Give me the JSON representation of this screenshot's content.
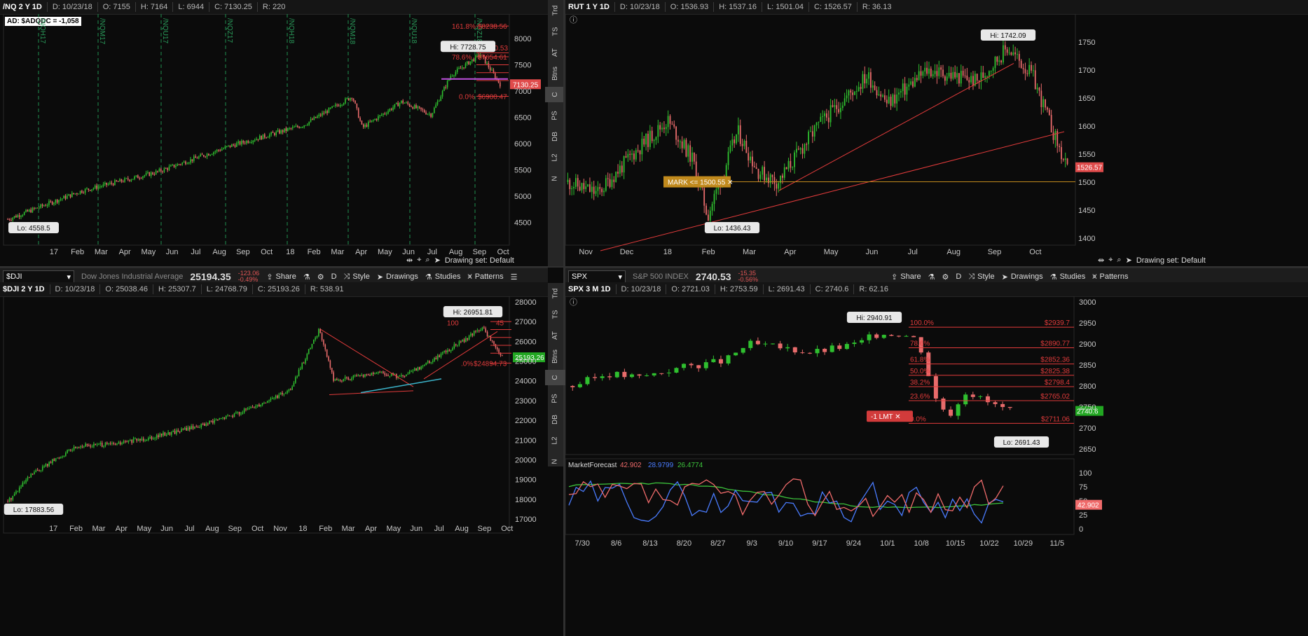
{
  "panels": {
    "nq": {
      "header": {
        "symbol": "/NQ 2 Y 1D",
        "date": "D: 10/23/18",
        "open": "O: 7155",
        "high": "H: 7164",
        "low": "L: 6944",
        "close": "C: 7130.25",
        "range": "R: 220"
      },
      "ad_label": "AD: $ADQDC = -1,058",
      "hi_label": "Hi: 7728.75",
      "lo_label": "Lo: 4558.5",
      "price_badge": "7130.25",
      "fib_labels": [
        "161.8%",
        "$8238.56",
        "78.6%",
        "$7654.61",
        "0.0%",
        "$6900.47",
        "30.53"
      ],
      "y_ticks": [
        "8000",
        "7500",
        "7000",
        "6500",
        "6000",
        "5500",
        "5000",
        "4500"
      ],
      "x_ticks": [
        "17",
        "Feb",
        "Mar",
        "Apr",
        "May",
        "Jun",
        "Jul",
        "Aug",
        "Sep",
        "Oct",
        "18",
        "Feb",
        "Mar",
        "Apr",
        "May",
        "Jun",
        "Jul",
        "Aug",
        "Sep",
        "Oct"
      ],
      "contract_marks": [
        "/NQH17",
        "/NQM17",
        "/NQU17",
        "/NQZ17",
        "/NQH18",
        "/NQM18",
        "/NQU18",
        "/NQZ18"
      ]
    },
    "rut": {
      "header": {
        "symbol": "RUT 1 Y 1D",
        "date": "D: 10/23/18",
        "open": "O: 1536.93",
        "high": "H: 1537.16",
        "low": "L: 1501.04",
        "close": "C: 1526.57",
        "range": "R: 36.13"
      },
      "hi_label": "Hi: 1742.09",
      "lo_label": "Lo: 1436.43",
      "mark_label": "MARK <= 1500.55",
      "price_badge": "1526.57",
      "y_ticks": [
        "1750",
        "1700",
        "1650",
        "1600",
        "1550",
        "1500",
        "1450",
        "1400"
      ],
      "x_ticks": [
        "Nov",
        "Dec",
        "18",
        "Feb",
        "Mar",
        "Apr",
        "May",
        "Jun",
        "Jul",
        "Aug",
        "Sep",
        "Oct"
      ],
      "drawing_set": "Drawing set: Default"
    },
    "dji": {
      "toolbar": {
        "symbol": "$DJI",
        "name": "Dow Jones Industrial Average",
        "price": "25194.35",
        "chg": "-123.06",
        "pct": "-0.49%"
      },
      "header": {
        "symbol": "$DJI 2 Y 1D",
        "date": "D: 10/23/18",
        "open": "O: 25038.46",
        "high": "H: 25307.7",
        "low": "L: 24768.79",
        "close": "C: 25193.26",
        "range": "R: 538.91"
      },
      "hi_label": "Hi: 26951.81",
      "lo_label": "Lo: 17883.56",
      "price_badge": "25193.26",
      "fib_labels": [
        "100",
        "45",
        ".0%",
        "$24894.73"
      ],
      "y_ticks": [
        "28000",
        "27000",
        "26000",
        "25000",
        "24000",
        "23000",
        "22000",
        "21000",
        "20000",
        "19000",
        "18000",
        "17000"
      ],
      "x_ticks": [
        "17",
        "Feb",
        "Mar",
        "Apr",
        "May",
        "Jun",
        "Jul",
        "Aug",
        "Sep",
        "Oct",
        "Nov",
        "18",
        "Feb",
        "Mar",
        "Apr",
        "May",
        "Jun",
        "Jul",
        "Aug",
        "Sep",
        "Oct"
      ]
    },
    "spx": {
      "toolbar": {
        "symbol": "SPX",
        "name": "S&P 500 INDEX",
        "price": "2740.53",
        "chg": "-15.35",
        "pct": "-0.56%"
      },
      "header": {
        "symbol": "SPX 3 M 1D",
        "date": "D: 10/23/18",
        "open": "O: 2721.03",
        "high": "H: 2753.59",
        "low": "L: 2691.43",
        "close": "C: 2740.6",
        "range": "R: 62.16"
      },
      "hi_label": "Hi: 2940.91",
      "lo_label": "Lo: 2691.43",
      "price_badge": "2740.6",
      "order_label": "-1 LMT",
      "fib": [
        {
          "pct": "100.0%",
          "price": "$2939.7"
        },
        {
          "pct": "78.6%",
          "price": "$2890.77"
        },
        {
          "pct": "61.8%",
          "price": "$2852.36"
        },
        {
          "pct": "50.0%",
          "price": "$2825.38"
        },
        {
          "pct": "38.2%",
          "price": "$2798.4"
        },
        {
          "pct": "23.6%",
          "price": "$2765.02"
        },
        {
          "pct": "0.0%",
          "price": "$2711.06"
        }
      ],
      "y_ticks": [
        "3000",
        "2950",
        "2900",
        "2850",
        "2800",
        "2750",
        "2700",
        "2650"
      ],
      "x_ticks": [
        "7/30",
        "8/6",
        "8/13",
        "8/20",
        "8/27",
        "9/3",
        "9/10",
        "9/17",
        "9/24",
        "10/1",
        "10/8",
        "10/15",
        "10/22",
        "10/29",
        "11/5"
      ],
      "study": {
        "name": "MarketForecast",
        "v1": "42.902",
        "v2": "28.9799",
        "v3": "26.4774",
        "badge": "42.902",
        "ticks": [
          "100",
          "75",
          "50",
          "25",
          "0"
        ]
      }
    }
  },
  "toolbar_labels": {
    "share": "Share",
    "d": "D",
    "style": "Style",
    "drawings": "Drawings",
    "studies": "Studies",
    "patterns": "Patterns"
  },
  "side_tabs": [
    "Trd",
    "TS",
    "AT",
    "Btns",
    "C",
    "PS",
    "DB",
    "L2",
    "N"
  ],
  "drawing_set": "Drawing set: Default",
  "colors": {
    "up": "#2fbf2f",
    "down": "#e86b6b",
    "fib": "#e23b3b",
    "accent": "#c18a1d",
    "purple": "#c050e0"
  }
}
